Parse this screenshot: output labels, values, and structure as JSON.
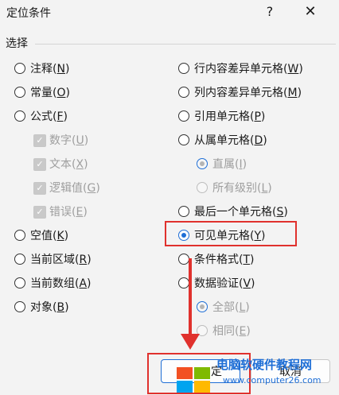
{
  "window": {
    "title": "定位条件",
    "help_icon": "?",
    "close_icon": "✕"
  },
  "group": {
    "label": "选择"
  },
  "left_options": [
    {
      "text": "注释",
      "key": "N",
      "state": "unselected"
    },
    {
      "text": "常量",
      "key": "O",
      "state": "unselected"
    },
    {
      "text": "公式",
      "key": "F",
      "state": "unselected"
    }
  ],
  "formula_suboptions": [
    {
      "text": "数字",
      "key": "U",
      "checked": true,
      "disabled": true
    },
    {
      "text": "文本",
      "key": "X",
      "checked": true,
      "disabled": true
    },
    {
      "text": "逻辑值",
      "key": "G",
      "checked": true,
      "disabled": true
    },
    {
      "text": "错误",
      "key": "E",
      "checked": true,
      "disabled": true
    }
  ],
  "left_options_2": [
    {
      "text": "空值",
      "key": "K"
    },
    {
      "text": "当前区域",
      "key": "R"
    },
    {
      "text": "当前数组",
      "key": "A"
    },
    {
      "text": "对象",
      "key": "B"
    }
  ],
  "right_options": [
    {
      "text": "行内容差异单元格",
      "key": "W"
    },
    {
      "text": "列内容差异单元格",
      "key": "M"
    },
    {
      "text": "引用单元格",
      "key": "P"
    },
    {
      "text": "从属单元格",
      "key": "D"
    }
  ],
  "dependents_suboptions": [
    {
      "text": "直属",
      "key": "I",
      "selected": true
    },
    {
      "text": "所有级别",
      "key": "L",
      "selected": false
    }
  ],
  "right_options_2": [
    {
      "text": "最后一个单元格",
      "key": "S",
      "selected": false
    },
    {
      "text": "可见单元格",
      "key": "Y",
      "selected": true
    },
    {
      "text": "条件格式",
      "key": "T",
      "selected": false
    },
    {
      "text": "数据验证",
      "key": "V",
      "selected": false
    }
  ],
  "validation_suboptions": [
    {
      "text": "全部",
      "key": "L",
      "selected": true
    },
    {
      "text": "相同",
      "key": "E",
      "selected": false
    }
  ],
  "buttons": {
    "ok_partial": "定",
    "cancel": "取消"
  },
  "watermark": {
    "line1": "电脑软硬件教程网",
    "line2": "www.computer26.com"
  },
  "colors": {
    "accent": "#1e6ed6",
    "annotation_red": "#e0312d"
  }
}
